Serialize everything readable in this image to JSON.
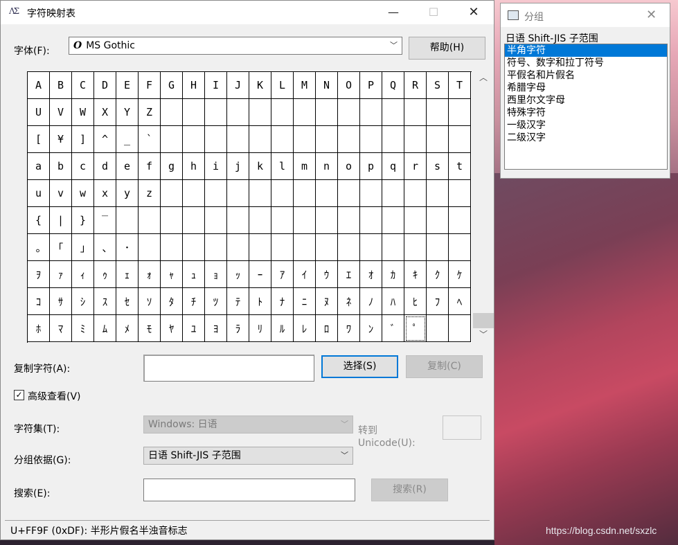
{
  "window": {
    "title": "字符映射表",
    "min_glyph": "—",
    "max_glyph": "☐",
    "close_glyph": "✕",
    "icon_text": "ΛΣ"
  },
  "font": {
    "label": "字体(F):",
    "value": "MS Gothic",
    "glyph": "O"
  },
  "help_button": "帮助(H)",
  "grid": [
    [
      "A",
      "B",
      "C",
      "D",
      "E",
      "F",
      "G",
      "H",
      "I",
      "J",
      "K",
      "L",
      "M",
      "N",
      "O",
      "P",
      "Q",
      "R",
      "S",
      "T"
    ],
    [
      "U",
      "V",
      "W",
      "X",
      "Y",
      "Z",
      "",
      "",
      "",
      "",
      "",
      "",
      "",
      "",
      "",
      "",
      "",
      "",
      "",
      ""
    ],
    [
      "[",
      "¥",
      "]",
      "^",
      "_",
      "`",
      "",
      "",
      "",
      "",
      "",
      "",
      "",
      "",
      "",
      "",
      "",
      "",
      "",
      ""
    ],
    [
      "a",
      "b",
      "c",
      "d",
      "e",
      "f",
      "g",
      "h",
      "i",
      "j",
      "k",
      "l",
      "m",
      "n",
      "o",
      "p",
      "q",
      "r",
      "s",
      "t"
    ],
    [
      "u",
      "v",
      "w",
      "x",
      "y",
      "z",
      "",
      "",
      "",
      "",
      "",
      "",
      "",
      "",
      "",
      "",
      "",
      "",
      "",
      ""
    ],
    [
      "{",
      "|",
      "}",
      "‾",
      "",
      "",
      "",
      "",
      "",
      "",
      "",
      "",
      "",
      "",
      "",
      "",
      "",
      "",
      "",
      ""
    ],
    [
      "｡",
      "｢",
      "｣",
      "､",
      "･",
      "",
      "",
      "",
      "",
      "",
      "",
      "",
      "",
      "",
      "",
      "",
      "",
      "",
      "",
      ""
    ],
    [
      "ｦ",
      "ｧ",
      "ｨ",
      "ｩ",
      "ｪ",
      "ｫ",
      "ｬ",
      "ｭ",
      "ｮ",
      "ｯ",
      "ｰ",
      "ｱ",
      "ｲ",
      "ｳ",
      "ｴ",
      "ｵ",
      "ｶ",
      "ｷ",
      "ｸ",
      "ｹ"
    ],
    [
      "ｺ",
      "ｻ",
      "ｼ",
      "ｽ",
      "ｾ",
      "ｿ",
      "ﾀ",
      "ﾁ",
      "ﾂ",
      "ﾃ",
      "ﾄ",
      "ﾅ",
      "ﾆ",
      "ﾇ",
      "ﾈ",
      "ﾉ",
      "ﾊ",
      "ﾋ",
      "ﾌ",
      "ﾍ"
    ],
    [
      "ﾎ",
      "ﾏ",
      "ﾐ",
      "ﾑ",
      "ﾒ",
      "ﾓ",
      "ﾔ",
      "ﾕ",
      "ﾖ",
      "ﾗ",
      "ﾘ",
      "ﾙ",
      "ﾚ",
      "ﾛ",
      "ﾜ",
      "ﾝ",
      "ﾞ",
      "ﾟ",
      "",
      ""
    ]
  ],
  "selected_cell": {
    "row": 9,
    "col": 17
  },
  "scrollbar": {
    "up_glyph": "︿",
    "down_glyph": "﹀"
  },
  "copy": {
    "label": "复制字符(A):",
    "value": "",
    "select_button": "选择(S)",
    "copy_button": "复制(C)"
  },
  "advanced": {
    "label": "高级查看(V)",
    "checked": "✓"
  },
  "charset": {
    "label": "字符集(T):",
    "value": "Windows: 日语"
  },
  "goto": {
    "label_line1": "转到",
    "label_line2": "Unicode(U):",
    "value": ""
  },
  "groupby": {
    "label": "分组依据(G):",
    "value": "日语 Shift-JIS 子范围"
  },
  "search": {
    "label": "搜索(E):",
    "value": "",
    "button": "搜索(R)"
  },
  "status": "U+FF9F (0xDF): 半形片假名半浊音标志",
  "group_window": {
    "title": "分组",
    "close_glyph": "✕",
    "heading": "日语 Shift-JIS 子范围",
    "items": [
      "半角字符",
      "符号、数字和拉丁符号",
      "平假名和片假名",
      "希腊字母",
      "西里尔文字母",
      "特殊字符",
      "一级汉字",
      "二级汉字"
    ],
    "selected_index": 0
  },
  "watermark": "https://blog.csdn.net/sxzlc"
}
